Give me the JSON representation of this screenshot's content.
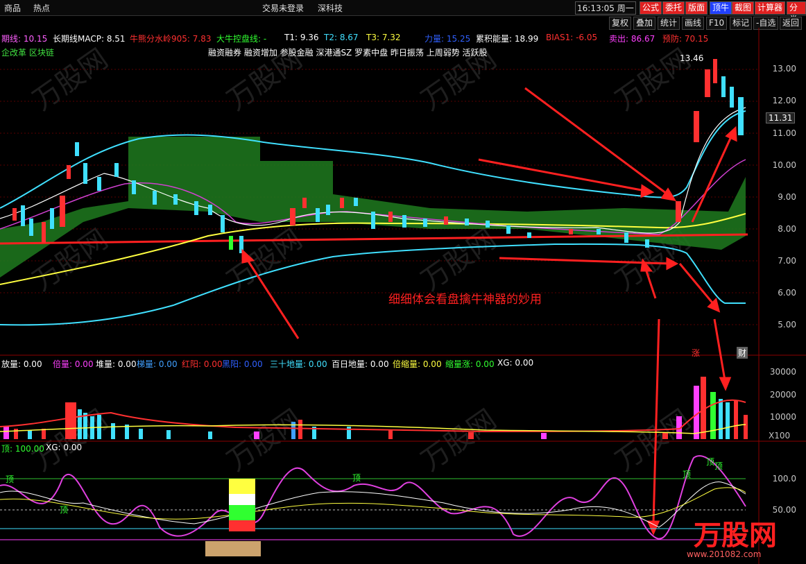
{
  "topbar": {
    "items": [
      "商品",
      "热点"
    ],
    "status": "交易未登录",
    "code": "深科技",
    "time": "16:13:05",
    "weekday": "周一",
    "buttons": [
      "公式",
      "委托",
      "版面",
      "顶牛",
      "截图",
      "计算器",
      "分类"
    ]
  },
  "toolbar2": [
    "复权",
    "叠加",
    "统计",
    "画线",
    "F10",
    "标记",
    "-自选",
    "返回"
  ],
  "main_indicators": [
    {
      "text": "期线: 10.15",
      "color": "#ff60ff"
    },
    {
      "text": "长期线MACP: 8.51",
      "color": "#ffffff"
    },
    {
      "text": "牛熊分水岭905: 7.83",
      "color": "#ff3030"
    },
    {
      "text": "大牛控盘线: -",
      "color": "#30ff30"
    },
    {
      "text": "T1: 9.36",
      "color": "#ffffff"
    },
    {
      "text": "T2: 8.67",
      "color": "#40e0ff"
    },
    {
      "text": "T3: 7.32",
      "color": "#ffff40"
    },
    {
      "text": "力量: 15.25",
      "color": "#3060ff"
    },
    {
      "text": "累积能量: 18.99",
      "color": "#ffffff"
    },
    {
      "text": "BIAS1: -6.05",
      "color": "#ff3030"
    },
    {
      "text": "卖出: 86.67",
      "color": "#ff40ff"
    },
    {
      "text": "预防: 70.15",
      "color": "#ff3030"
    }
  ],
  "tags_line": "企改革 区块链",
  "concepts_line": "融资融券 融资增加 参股金融 深港通SZ 罗素中盘 昨日振荡 上周弱势 活跃股",
  "price_axis": [
    "13.00",
    "12.00",
    "11.00",
    "10.00",
    "9.00",
    "8.00",
    "7.00",
    "6.00",
    "5.00"
  ],
  "current_price": "11.31",
  "high_label": "13.46",
  "annotation": "细细体会看盘擒牛神器的妙用",
  "markers": {
    "zhang": "涨",
    "caibao": "财"
  },
  "volume_indicators": [
    {
      "text": "放量: 0.00",
      "color": "#ffffff"
    },
    {
      "text": "倍量: 0.00",
      "color": "#ff40ff"
    },
    {
      "text": "堆量: 0.00",
      "color": "#ffffff"
    },
    {
      "text": "梯量: 0.00",
      "color": "#40a0ff"
    },
    {
      "text": "红阳: 0.00",
      "color": "#ff3030"
    },
    {
      "text": "黑阳: 0.00",
      "color": "#3060ff"
    },
    {
      "text": "三十地量: 0.00",
      "color": "#40e0ff"
    },
    {
      "text": "百日地量: 0.00",
      "color": "#ffffff"
    },
    {
      "text": "倍缩量: 0.00",
      "color": "#ffff40"
    },
    {
      "text": "缩量涨: 0.00",
      "color": "#30ff30"
    },
    {
      "text": "XG: 0.00",
      "color": "#ffffff"
    }
  ],
  "volume_axis": [
    "30000",
    "20000",
    "10000"
  ],
  "volume_unit": "X100",
  "osc_indicators": [
    {
      "text": "顶: 100.00",
      "color": "#30ff30"
    },
    {
      "text": "XG: 0.00",
      "color": "#ffffff"
    }
  ],
  "osc_axis": [
    "100.0",
    "50.00"
  ],
  "osc_labels": [
    "顶",
    "顶",
    "顶",
    "顶",
    "顶",
    "顶"
  ],
  "watermark": "万股网",
  "watermark_url": "www.201082.com",
  "colors": {
    "up": "#ff3030",
    "down": "#40e0ff",
    "band": "#1f7a1f",
    "accent": "#ff2020"
  }
}
